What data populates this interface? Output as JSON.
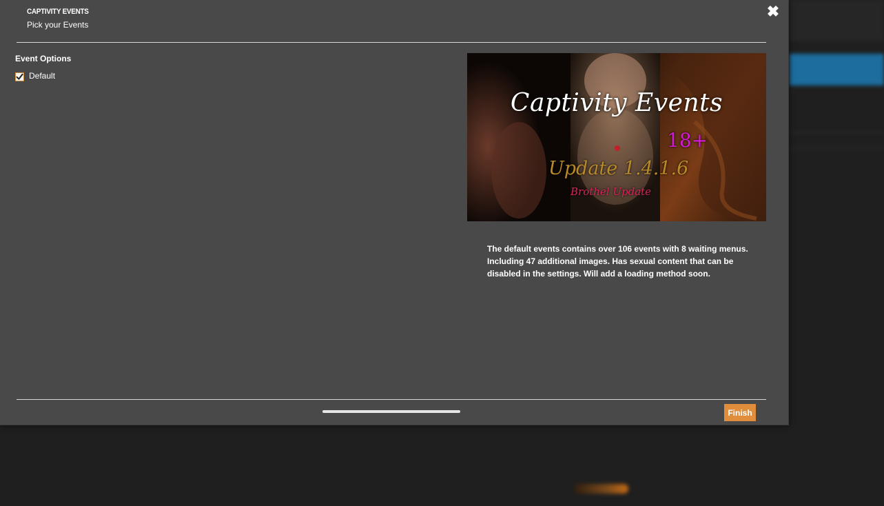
{
  "dialog": {
    "title": "CAPTIVITY EVENTS",
    "subtitle": "Pick your Events",
    "close_icon": "close-icon"
  },
  "options": {
    "heading": "Event Options",
    "items": [
      {
        "label": "Default",
        "checked": true
      }
    ]
  },
  "preview": {
    "title": "Captivity Events",
    "rating": "18+",
    "version": "Update 1.4.1.6",
    "subtitle": "Brothel Update",
    "description": "The default events contains over 106 events with 8 waiting menus. Including 47 additional images. Has sexual content that can be disabled in the settings. Will add a loading method soon."
  },
  "footer": {
    "finish_label": "Finish"
  },
  "colors": {
    "modal_bg": "#494949",
    "accent": "#e08d3c",
    "rating_magenta": "#d31ad3",
    "version_gold": "#b88a2a",
    "subtitle_red": "#d6245a"
  }
}
